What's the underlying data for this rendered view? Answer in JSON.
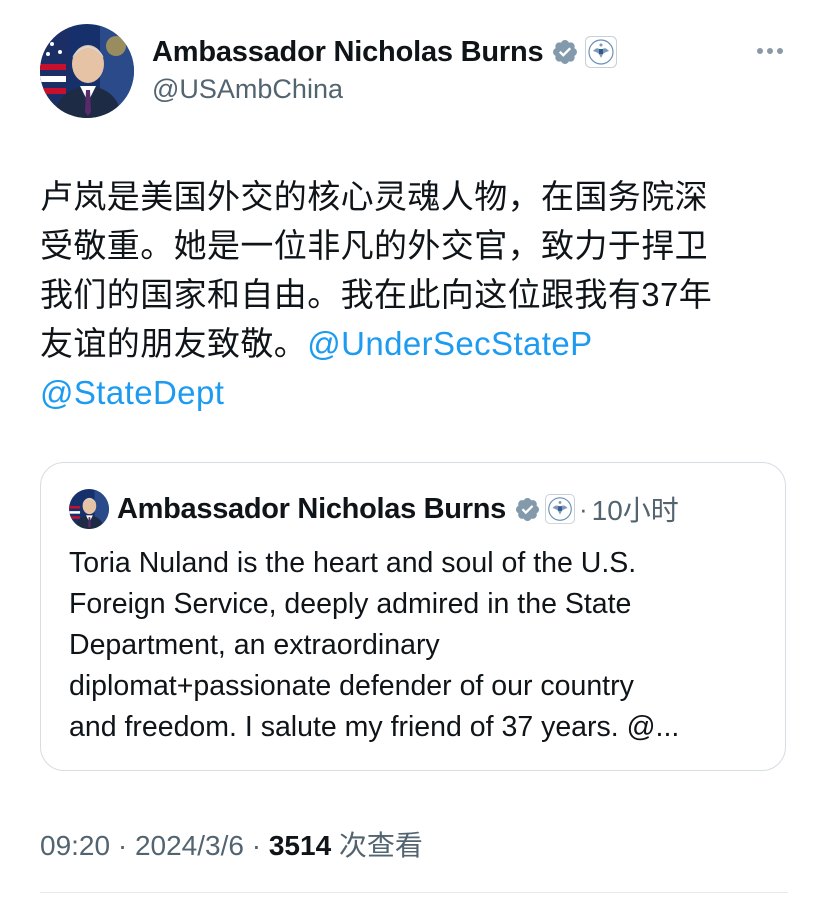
{
  "tweet": {
    "author": {
      "name": "Ambassador Nicholas Burns",
      "handle": "@USAmbChina"
    },
    "text_lines": [
      "卢岚是美国外交的核心灵魂人物，在国务院深",
      "受敬重。她是一位非凡的外交官，致力于捍卫",
      "我们的国家和自由。我在此向这位跟我有37年",
      "友谊的朋友致敬。"
    ],
    "mentions": [
      "@UnderSecStateP",
      "@StateDept"
    ],
    "meta": {
      "time": "09:20",
      "separator": " · ",
      "date": "2024/3/6",
      "views": "3514",
      "views_label": " 次查看"
    }
  },
  "quoted_tweet": {
    "author": {
      "name": "Ambassador Nicholas Burns"
    },
    "dot": "·",
    "time_ago": "10小时",
    "text_lines": [
      "Toria Nuland is the heart and soul of the U.S.",
      "Foreign Service, deeply admired in the State",
      "Department, an extraordinary",
      "diplomat+passionate defender of our country",
      "and freedom.  I salute my friend of 37 years. @..."
    ]
  },
  "icons": {
    "verified": "verified-badge-icon",
    "affiliation": "us-embassy-seal-icon",
    "more": "more-horizontal-icon"
  },
  "colors": {
    "link": "#1d9bf0",
    "muted": "#536471",
    "verified_gray": "#829aab",
    "text": "#0f1419"
  }
}
